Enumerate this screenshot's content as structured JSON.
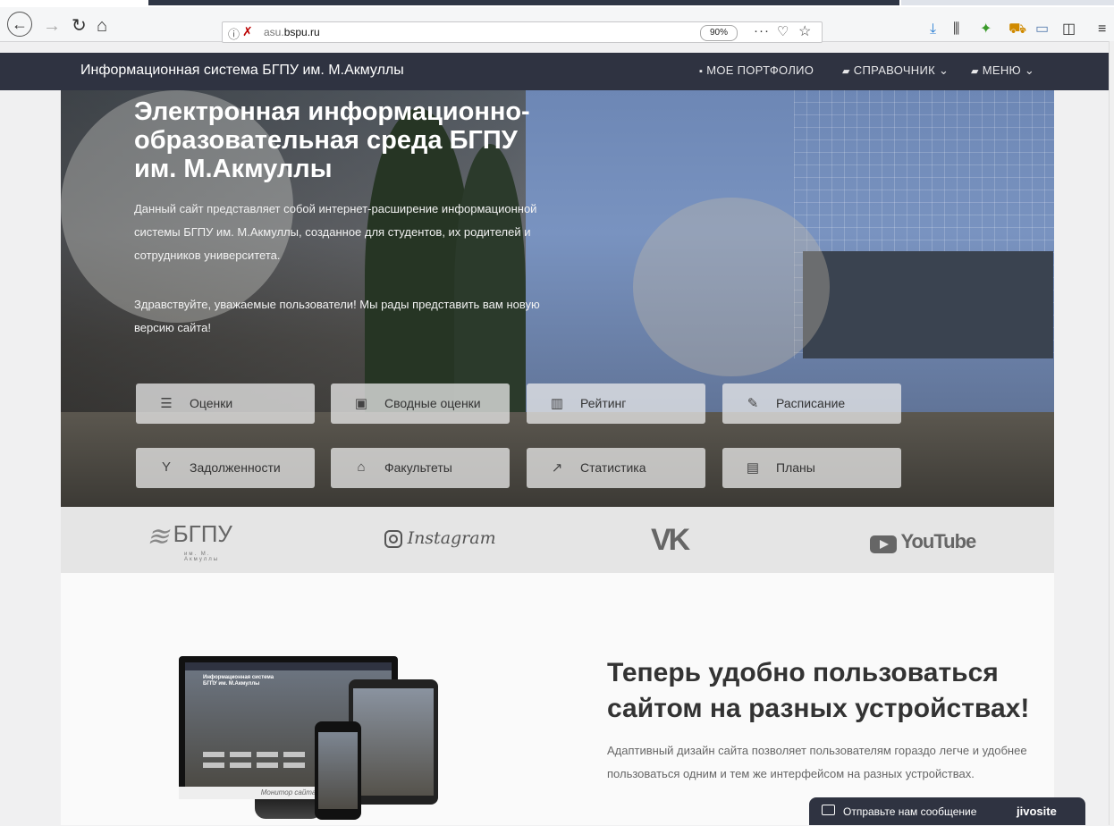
{
  "browser": {
    "url_host": "asu.",
    "url_domain": "bspu.ru",
    "zoom": "90%",
    "more_label": "···"
  },
  "navbar": {
    "title": "Информационная система БГПУ им. М.Акмуллы",
    "links": [
      {
        "label": "МОЕ ПОРТФОЛИО",
        "icon": "briefcase-icon"
      },
      {
        "label": "СПРАВОЧНИК",
        "icon": "book-icon"
      },
      {
        "label": "МЕНЮ",
        "icon": "book-icon"
      }
    ]
  },
  "hero": {
    "title": "Электронная информационно-образовательная среда БГПУ им. М.Акмуллы",
    "paragraph1": "Данный сайт представляет собой интернет-расширение информационной системы БГПУ им. М.Акмуллы, созданное для студентов, их родителей и сотрудников университета.",
    "paragraph2": "Здравствуйте, уважаемые пользователи! Мы рады представить вам новую версию сайта!",
    "tiles": [
      {
        "label": "Оценки",
        "icon": "list-icon",
        "glyph": "☰"
      },
      {
        "label": "Сводные оценки",
        "icon": "car-icon",
        "glyph": "▣"
      },
      {
        "label": "Рейтинг",
        "icon": "bar-chart-icon",
        "glyph": "▥"
      },
      {
        "label": "Расписание",
        "icon": "edit-icon",
        "glyph": "✎"
      },
      {
        "label": "Задолженности",
        "icon": "yandex-icon",
        "glyph": "Y"
      },
      {
        "label": "Факультеты",
        "icon": "university-icon",
        "glyph": "⌂"
      },
      {
        "label": "Статистика",
        "icon": "line-chart-icon",
        "glyph": "↗"
      },
      {
        "label": "Планы",
        "icon": "newspaper-icon",
        "glyph": "▤"
      }
    ]
  },
  "social": {
    "bspu": "БГПУ",
    "bspu_sub": "им. М. Акмуллы",
    "instagram": "Instagram",
    "vk": "VK",
    "youtube": "YouTube"
  },
  "devices_section": {
    "heading": "Теперь удобно пользоваться сайтом на разных устройствах!",
    "text": "Адаптивный дизайн сайта позволяет пользователям гораздо легче и удобнее пользоваться одним и тем же интерфейсом на разных устройствах.",
    "mock_screen_title": "Информационная система БГПУ им. М.Акмуллы",
    "mock_caption": "Монитор сайта"
  },
  "chat": {
    "message": "Отправьте нам сообщение",
    "brand": "jivosite"
  },
  "colors": {
    "navbar_bg": "#2f3341",
    "tile_bg": "rgba(235,235,235,0.75)",
    "social_strip_bg": "#e5e5e5"
  }
}
